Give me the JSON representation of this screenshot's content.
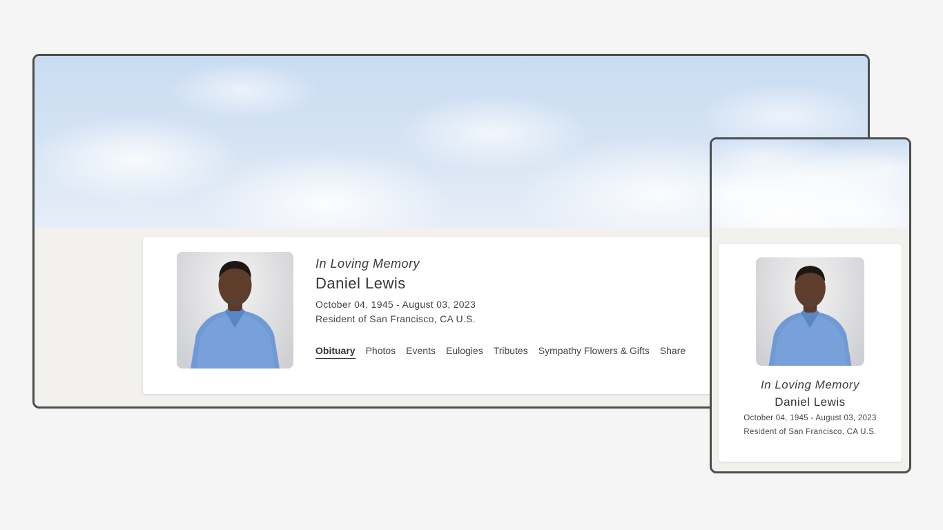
{
  "memorial": {
    "memory_label": "In Loving Memory",
    "name": "Daniel Lewis",
    "dates": "October 04, 1945 - August 03, 2023",
    "residence": "Resident of San Francisco, CA U.S."
  },
  "nav": {
    "tabs": [
      {
        "label": "Obituary",
        "active": true
      },
      {
        "label": "Photos"
      },
      {
        "label": "Events"
      },
      {
        "label": "Eulogies"
      },
      {
        "label": "Tributes"
      },
      {
        "label": "Sympathy Flowers & Gifts"
      },
      {
        "label": "Share"
      }
    ]
  },
  "colors": {
    "frame_border": "#4a4d4a",
    "page_background": "#f2f1ee",
    "sky": "#c9dcf2",
    "shirt": "#6f9ad6"
  },
  "icons": {
    "portrait": "man-in-blue-gingham-shirt-photo",
    "banner": "cloudy-sky-banner"
  }
}
